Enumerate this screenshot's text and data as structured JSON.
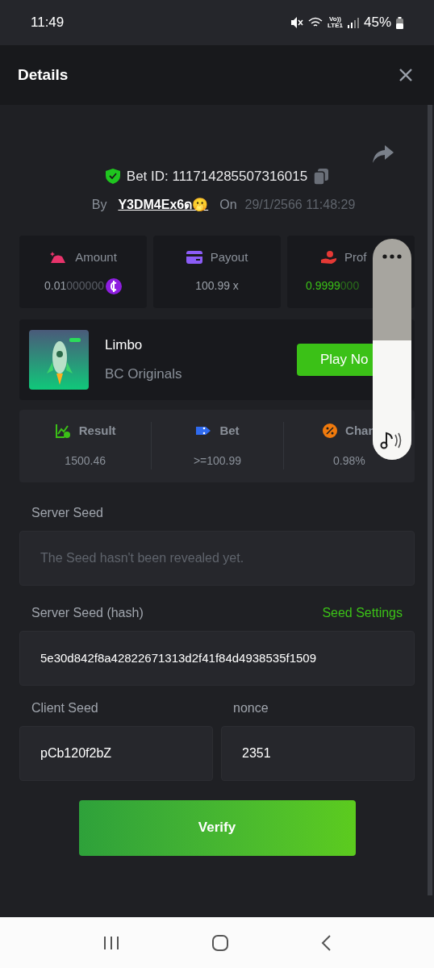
{
  "status_bar": {
    "time": "11:49",
    "volte": "Vo))",
    "lte": "LTE1",
    "battery": "45%"
  },
  "header": {
    "title": "Details"
  },
  "bet": {
    "id_label": "Bet ID: 111714285507316015",
    "by_label": "By",
    "user": "Y3DM4Ex6ด🫢",
    "on_label": "On",
    "date": "29/1/2566 11:48:29"
  },
  "stats": [
    {
      "kind": "amount",
      "label": "Amount",
      "value": "0.01",
      "value_tail": "000000"
    },
    {
      "kind": "payout",
      "label": "Payout",
      "value": "100.99 x"
    },
    {
      "kind": "profit",
      "label": "Prof",
      "value": "0.9999",
      "value_tail": "000"
    }
  ],
  "game": {
    "name": "Limbo",
    "provider": "BC Originals",
    "play_button": "Play No"
  },
  "results": [
    {
      "kind": "result",
      "label": "Result",
      "value": "1500.46"
    },
    {
      "kind": "bet",
      "label": "Bet",
      "value": ">=100.99"
    },
    {
      "kind": "chance",
      "label": "Chan",
      "value": "0.98%"
    }
  ],
  "server_seed": {
    "label": "Server Seed",
    "placeholder": "The Seed hasn't been revealed yet."
  },
  "server_hash": {
    "label": "Server Seed (hash)",
    "link": "Seed Settings",
    "value": "5e30d842f8a42822671313d2f41f84d4938535f1509"
  },
  "client_seed": {
    "label": "Client Seed",
    "value": "pCb120f2bZ"
  },
  "nonce": {
    "label": "nonce",
    "value": "2351"
  },
  "verify_button": "Verify",
  "volume": {
    "level": 0.54
  }
}
